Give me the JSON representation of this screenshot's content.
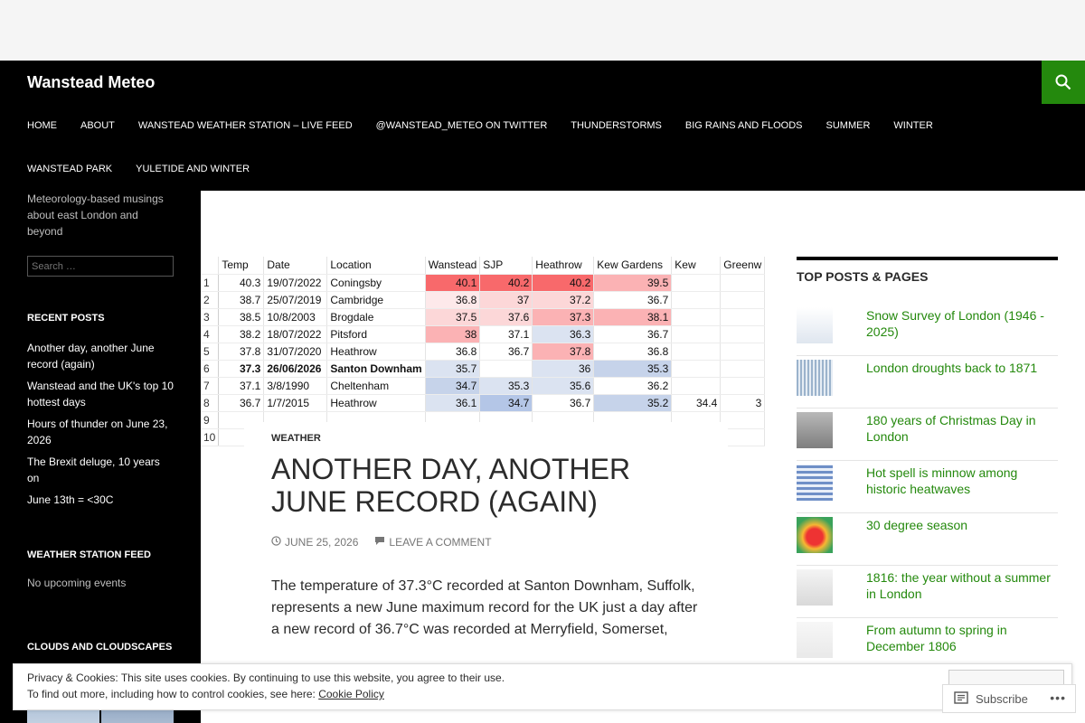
{
  "site": {
    "title": "Wanstead Meteo"
  },
  "nav": [
    "HOME",
    "ABOUT",
    "WANSTEAD WEATHER STATION – LIVE FEED",
    "@WANSTEAD_METEO ON TWITTER",
    "THUNDERSTORMS",
    "BIG RAINS AND FLOODS",
    "SUMMER",
    "WINTER",
    "WANSTEAD PARK",
    "YULETIDE AND WINTER"
  ],
  "sidebar": {
    "tagline": "Meteorology-based musings about east London and beyond",
    "search_placeholder": "Search …",
    "recent_title": "RECENT POSTS",
    "recent_posts": [
      "Another day, another June record (again)",
      "Wanstead and the UK's top 10 hottest days",
      "Hours of thunder on June 23, 2026",
      "The Brexit deluge, 10 years on",
      "June 13th = <30C"
    ],
    "station_title": "WEATHER STATION FEED",
    "station_text": "No upcoming events",
    "clouds_title": "CLOUDS AND CLOUDSCAPES"
  },
  "table": {
    "headers": [
      "",
      "Temp",
      "Date",
      "Location",
      "Wanstead",
      "SJP",
      "Heathrow",
      "Kew Gardens",
      "Kew",
      "Greenw"
    ],
    "rows": [
      [
        "1",
        "40.3",
        "19/07/2022",
        "Coningsby",
        "40.1",
        "40.2",
        "40.2",
        "39.5",
        "",
        ""
      ],
      [
        "2",
        "38.7",
        "25/07/2019",
        "Cambridge",
        "36.8",
        "37",
        "37.2",
        "36.7",
        "",
        ""
      ],
      [
        "3",
        "38.5",
        "10/8/2003",
        "Brogdale",
        "37.5",
        "37.6",
        "37.3",
        "38.1",
        "",
        ""
      ],
      [
        "4",
        "38.2",
        "18/07/2022",
        "Pitsford",
        "38",
        "37.1",
        "36.3",
        "36.7",
        "",
        ""
      ],
      [
        "5",
        "37.8",
        "31/07/2020",
        "Heathrow",
        "36.8",
        "36.7",
        "37.8",
        "36.8",
        "",
        ""
      ],
      [
        "6",
        "37.3",
        "26/06/2026",
        "Santon Downham",
        "35.7",
        "",
        "36",
        "35.3",
        "",
        ""
      ],
      [
        "7",
        "37.1",
        "3/8/1990",
        "Cheltenham",
        "34.7",
        "35.3",
        "35.6",
        "36.2",
        "",
        ""
      ],
      [
        "8",
        "36.7",
        "1/7/2015",
        "Heathrow",
        "36.1",
        "34.7",
        "36.7",
        "35.2",
        "34.4",
        "3"
      ],
      [
        "9",
        "",
        "",
        "",
        "",
        "",
        "",
        "",
        "",
        ""
      ],
      [
        "10",
        "",
        "",
        "",
        "",
        "",
        "",
        "",
        "",
        ""
      ]
    ],
    "colors": {
      "r1": "#f8696b",
      "r2": "#fbb2b4",
      "r3": "#fcd7d8",
      "r4": "#fde9ea",
      "b1": "#dbe3f1",
      "b2": "#c6d3ea",
      "b3": "#b4c6e7",
      "w": "#ffffff"
    }
  },
  "post": {
    "category": "WEATHER",
    "title": "ANOTHER DAY, ANOTHER JUNE RECORD (AGAIN)",
    "date": "JUNE 25, 2026",
    "comment": "LEAVE A COMMENT",
    "body": "The temperature of 37.3°C recorded at Santon Downham, Suffolk, represents a new June maximum record for the UK just a day after a new record of 36.7°C was recorded at Merryfield, Somerset,"
  },
  "top_posts": {
    "title": "TOP POSTS & PAGES",
    "items": [
      "Snow Survey of London (1946 - 2025)",
      "London droughts back to 1871",
      "180 years of Christmas Day in London",
      "Hot spell is minnow among historic heatwaves",
      "30 degree season",
      "1816: the year without a summer in London",
      "From autumn to spring in December 1806"
    ]
  },
  "cookie": {
    "line1": "Privacy & Cookies: This site uses cookies. By continuing to use this website, you agree to their use.",
    "line2": "To find out more, including how to control cookies, see here: ",
    "link": "Cookie Policy"
  },
  "subscribe": {
    "label": "Subscribe"
  },
  "colors": {
    "accent": "#24890d",
    "masthead": "#000000"
  }
}
